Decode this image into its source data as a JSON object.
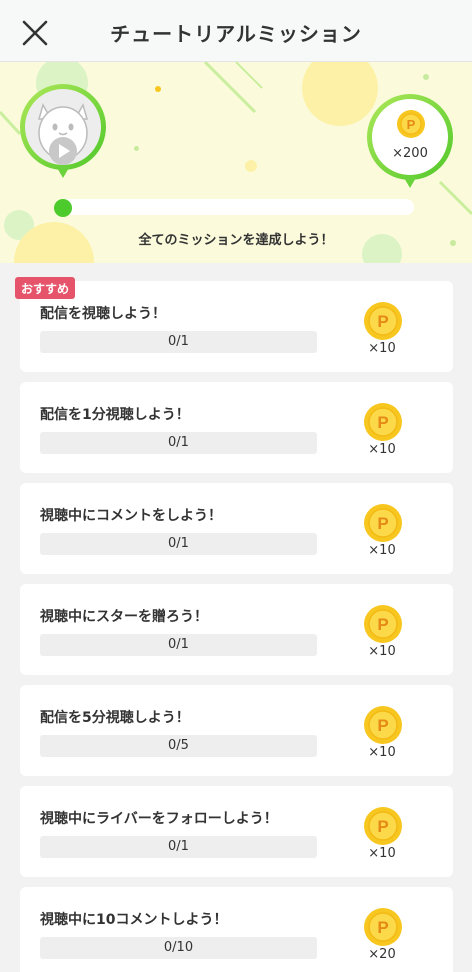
{
  "header": {
    "title": "チュートリアルミッション",
    "close_icon": "close-icon"
  },
  "hero": {
    "total_reward": "×200",
    "message": "全てのミッションを達成しよう！",
    "progress": 0
  },
  "badge": "おすすめ",
  "missions": [
    {
      "title": "配信を視聴しよう！",
      "progress": "0/1",
      "reward": "×10"
    },
    {
      "title": "配信を1分視聴しよう！",
      "progress": "0/1",
      "reward": "×10"
    },
    {
      "title": "視聴中にコメントをしよう！",
      "progress": "0/1",
      "reward": "×10"
    },
    {
      "title": "視聴中にスターを贈ろう！",
      "progress": "0/1",
      "reward": "×10"
    },
    {
      "title": "配信を5分視聴しよう！",
      "progress": "0/5",
      "reward": "×10"
    },
    {
      "title": "視聴中にライバーをフォローしよう！",
      "progress": "0/1",
      "reward": "×10"
    },
    {
      "title": "視聴中に10コメントしよう！",
      "progress": "0/10",
      "reward": "×20"
    }
  ],
  "colors": {
    "accent_green": "#4ecb2c",
    "badge_red": "#e5546a",
    "coin_yellow": "#f7c720"
  }
}
